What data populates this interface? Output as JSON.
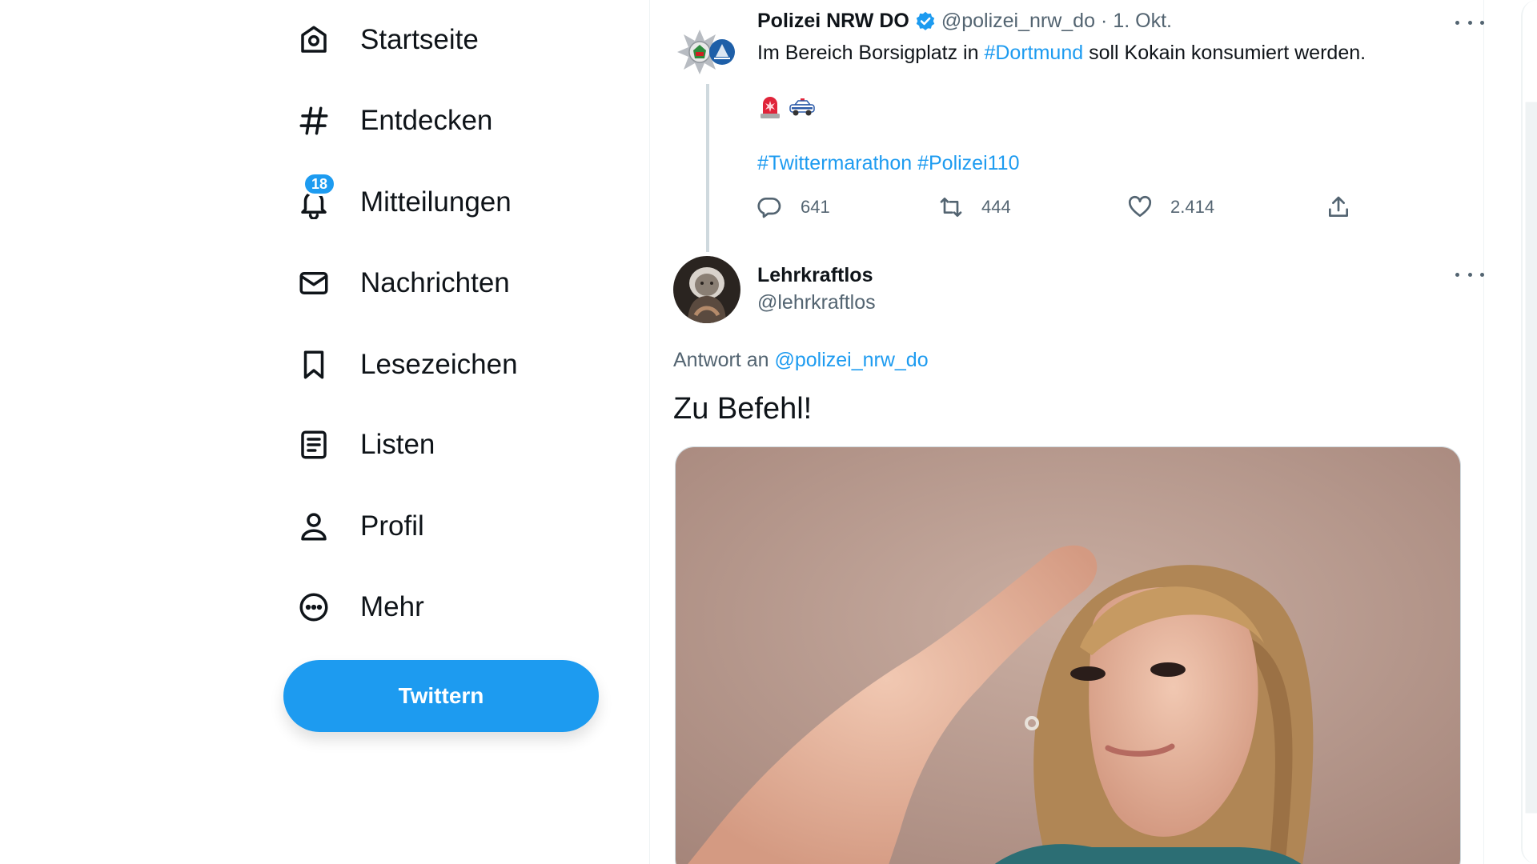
{
  "nav": {
    "items": [
      {
        "label": "Startseite",
        "icon": "home-icon"
      },
      {
        "label": "Entdecken",
        "icon": "hashtag-icon"
      },
      {
        "label": "Mitteilungen",
        "icon": "bell-icon",
        "badge": "18"
      },
      {
        "label": "Nachrichten",
        "icon": "envelope-icon"
      },
      {
        "label": "Lesezeichen",
        "icon": "bookmark-icon"
      },
      {
        "label": "Listen",
        "icon": "list-icon"
      },
      {
        "label": "Profil",
        "icon": "person-icon"
      },
      {
        "label": "Mehr",
        "icon": "more-circle-icon"
      }
    ],
    "tweet_button": "Twittern"
  },
  "tweet1": {
    "name": "Polizei NRW DO",
    "handle": "@polizei_nrw_do",
    "separator": "·",
    "date": "1. Okt.",
    "text_before": "Im Bereich Borsigplatz in ",
    "hashtag_inline": "#Dortmund",
    "text_after": " soll Kokain konsumiert werden.",
    "emojis": [
      "rotating-light-emoji",
      "police-car-emoji"
    ],
    "hashtags": "#Twittermarathon #Polizei110",
    "replies": "641",
    "retweets": "444",
    "likes": "2.414"
  },
  "tweet2": {
    "name": "Lehrkraftlos",
    "handle": "@lehrkraftlos",
    "reply_prefix": "Antwort an ",
    "reply_handle": "@polizei_nrw_do",
    "text": "Zu Befehl!"
  },
  "colors": {
    "accent": "#1d9bf0",
    "text_primary": "#0f1419",
    "text_secondary": "#536471",
    "border": "#eff3f4"
  }
}
